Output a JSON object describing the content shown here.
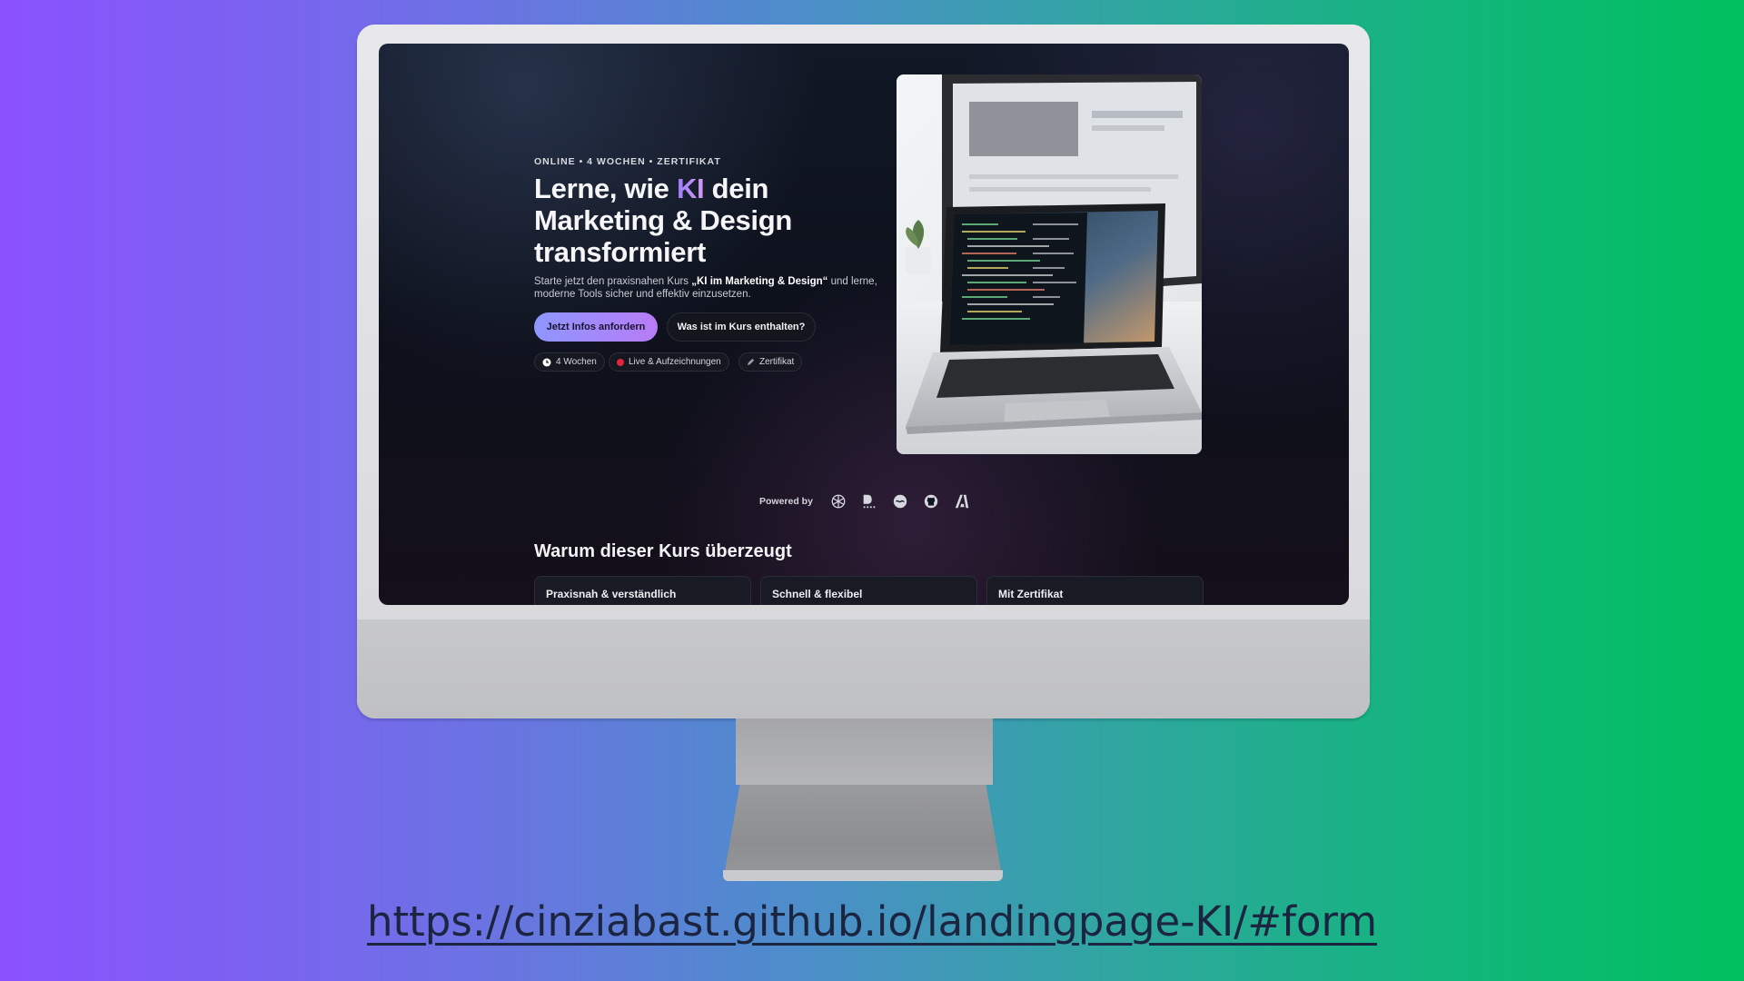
{
  "hero": {
    "eyebrow": "ONLINE • 4 WOCHEN • ZERTIFIKAT",
    "headline_part1": "Lerne, wie ",
    "headline_accent": "KI",
    "headline_part2": " dein Marketing & Design transformiert",
    "lead_part1": "Starte jetzt den praxisnahen Kurs ",
    "lead_course": "„KI im Marketing & Design“",
    "lead_part2": " und lerne, moderne Tools sicher und effektiv einzusetzen.",
    "primary_button": "Jetzt Infos anfordern",
    "secondary_button": "Was ist im Kurs enthalten?",
    "chips": [
      {
        "label": "4 Wochen",
        "icon": "clock-icon"
      },
      {
        "label": "Live & Aufzeichnungen",
        "icon": "record-icon"
      },
      {
        "label": "Zertifikat",
        "icon": "pen-icon"
      }
    ]
  },
  "powered_by": {
    "label": "Powered by",
    "logos": [
      "openai-logo-icon",
      "dalle-logo-icon",
      "canva-logo-icon",
      "github-logo-icon",
      "adobe-logo-icon"
    ]
  },
  "section": {
    "title": "Warum dieser Kurs überzeugt",
    "cards": [
      "Praxisnah & verständlich",
      "Schnell & flexibel",
      "Mit Zertifikat"
    ]
  },
  "footer": {
    "url": "https://cinziabast.github.io/landingpage-KI/#form"
  },
  "colors": {
    "background_left": "#8b51ff",
    "background_right": "#00c05f",
    "screen_background": "#0d111c",
    "primary_button_start": "#8e96ff",
    "primary_button_end": "#b77cf5",
    "record_dot": "#e0263a"
  }
}
